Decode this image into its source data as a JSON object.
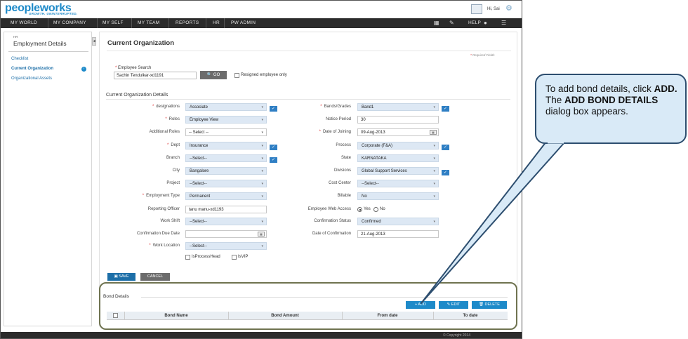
{
  "header": {
    "logo_main": "peopleworks",
    "tagline": "GROWTH. UNINTERRUPTED.",
    "greeting": "Hi, Sai",
    "nav": [
      "MY WORLD",
      "MY COMPANY",
      "MY SELF",
      "MY TEAM",
      "REPORTS",
      "HR",
      "PW ADMIN"
    ],
    "help_label": "HELP"
  },
  "sidebar": {
    "section": "HR",
    "title": "Employment Details",
    "links": [
      "Checklist",
      "Current Organization",
      "Organizational Assets"
    ]
  },
  "main": {
    "title": "Current Organization",
    "required_note": "Required Fields",
    "employee_search_label": "Employee Search",
    "employee_search_value": "Sachin Tendulkar-xd1191",
    "go_label": "GO",
    "resigned_label": "Resigned employee only",
    "section_title": "Current Organization Details",
    "left_fields": [
      {
        "label": "designations",
        "value": "Associate",
        "required": true
      },
      {
        "label": "Roles",
        "value": "Employee View",
        "required": true
      },
      {
        "label": "Additional Roles",
        "value": "-- Select --",
        "required": false
      },
      {
        "label": "Dept",
        "value": "Insurance",
        "required": true
      },
      {
        "label": "Branch",
        "value": "--Select--",
        "required": false
      },
      {
        "label": "City",
        "value": "Bangalore",
        "required": false
      },
      {
        "label": "Project",
        "value": "--Select--",
        "required": false
      },
      {
        "label": "Employment Type",
        "value": "Permanent",
        "required": true
      },
      {
        "label": "Reporting Officer",
        "value": "tanu manu-xd1193",
        "required": false
      },
      {
        "label": "Work Shift",
        "value": "--Select--",
        "required": false
      },
      {
        "label": "Confirmation Due Date",
        "value": "",
        "required": false
      },
      {
        "label": "Work Location",
        "value": "--Select--",
        "required": true
      }
    ],
    "right_fields": [
      {
        "label": "Bands/Grades",
        "value": "Band1",
        "required": true
      },
      {
        "label": "Notice Period",
        "value": "30",
        "required": false
      },
      {
        "label": "Date of Joining",
        "value": "09-Aug-2013",
        "required": true
      },
      {
        "label": "Process",
        "value": "Corporate (F&A)",
        "required": false
      },
      {
        "label": "State",
        "value": "KARNATAKA",
        "required": false
      },
      {
        "label": "Divisions",
        "value": "Global Support Services",
        "required": false
      },
      {
        "label": "Cost Center",
        "value": "--Select--",
        "required": false
      },
      {
        "label": "Billable",
        "value": "No",
        "required": false
      },
      {
        "label": "Employee Web Access",
        "value": "",
        "required": false
      },
      {
        "label": "Confirmation Status",
        "value": "Confirmed",
        "required": false
      },
      {
        "label": "Date of Confirmation",
        "value": "21-Aug-2013",
        "required": false
      }
    ],
    "web_access_yes": "Yes",
    "web_access_no": "No",
    "is_process_head": "IsProcessHead",
    "is_vip": "IsVIP",
    "save_label": "SAVE",
    "cancel_label": "CANCEL"
  },
  "bond": {
    "title": "Bond Details",
    "add_label": "ADD",
    "edit_label": "EDIT",
    "delete_label": "DELETE",
    "columns": [
      "Bond Name",
      "Bond Amount",
      "From date",
      "To date"
    ]
  },
  "footer": {
    "copyright": "© Copyright 2014"
  },
  "callout": {
    "line1": "To add bond details, click",
    "bold1": "ADD.",
    "mid": " The ",
    "bold2": "ADD BOND DETAILS",
    "end": " dialog box appears."
  },
  "colors": {
    "accent": "#1d8ac9",
    "navbar": "#2b2b2b",
    "callout_bg": "#d9eaf7",
    "callout_border": "#2d4e6f"
  }
}
